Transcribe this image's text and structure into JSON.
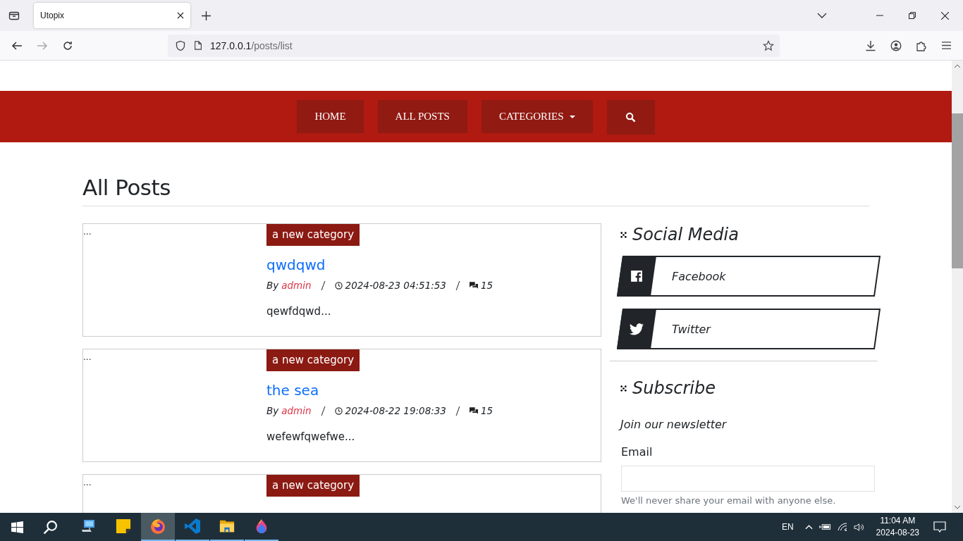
{
  "browser": {
    "tab": {
      "title": "Utopix",
      "selected": true
    },
    "url_host": "127.0.0.1",
    "url_path": "/posts/list"
  },
  "nav": {
    "items": [
      {
        "label": "HOME",
        "kind": "link"
      },
      {
        "label": "ALL POSTS",
        "kind": "link"
      },
      {
        "label": "CATEGORIES",
        "kind": "dropdown"
      },
      {
        "kind": "search"
      }
    ]
  },
  "page_title": "All Posts",
  "posts": [
    {
      "image_alt": "...",
      "category": "a new category",
      "title": "qwdqwd",
      "by": "By",
      "author": "admin",
      "date": "2024-08-23 04:51:53",
      "comments": "15",
      "excerpt": "qewfdqwd..."
    },
    {
      "image_alt": "...",
      "category": "a new category",
      "title": "the sea",
      "by": "By",
      "author": "admin",
      "date": "2024-08-22 19:08:33",
      "comments": "15",
      "excerpt": "wefewfqwefwe..."
    },
    {
      "image_alt": "...",
      "category": "a new category"
    }
  ],
  "sidebar": {
    "social": {
      "title": "Social Media",
      "links": [
        {
          "label": "Facebook",
          "kind": "facebook"
        },
        {
          "label": "Twitter",
          "kind": "twitter"
        }
      ]
    },
    "subscribe": {
      "title": "Subscribe",
      "text": "Join our newsletter",
      "email_label": "Email",
      "help": "We'll never share your email with anyone else."
    }
  },
  "taskbar": {
    "apps": [
      {
        "kind": "computer",
        "selected": false,
        "running": false
      },
      {
        "kind": "note",
        "selected": false,
        "running": false
      },
      {
        "kind": "firefox",
        "selected": true,
        "running": true
      },
      {
        "kind": "code",
        "selected": false,
        "running": true
      },
      {
        "kind": "folder",
        "selected": false,
        "running": true
      },
      {
        "kind": "drop",
        "selected": false,
        "running": true
      }
    ],
    "language": "EN",
    "time": "11:04 AM",
    "date": "2024-08-23"
  }
}
